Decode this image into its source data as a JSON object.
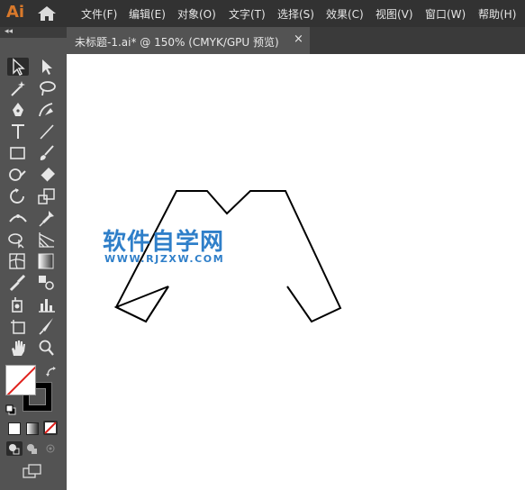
{
  "app": {
    "logo_text": "Ai"
  },
  "menu": {
    "items": [
      "文件(F)",
      "编辑(E)",
      "对象(O)",
      "文字(T)",
      "选择(S)",
      "效果(C)",
      "视图(V)",
      "窗口(W)",
      "帮助(H)"
    ]
  },
  "document": {
    "tab_title": "未标题-1.ai* @ 150% (CMYK/GPU 预览)",
    "close_glyph": "×"
  },
  "toolbar": {
    "collapse_glyph": "◂◂",
    "tools": [
      "selection-tool",
      "direct-selection-tool",
      "magic-wand-tool",
      "lasso-tool",
      "pen-tool",
      "curvature-tool",
      "type-tool",
      "line-segment-tool",
      "rectangle-tool",
      "paintbrush-tool",
      "shaper-tool",
      "eraser-tool",
      "rotate-tool",
      "scale-tool",
      "width-tool",
      "puppet-warp-tool",
      "shape-builder-tool",
      "perspective-grid-tool",
      "mesh-tool",
      "gradient-tool",
      "eyedropper-tool",
      "blend-tool",
      "symbol-sprayer-tool",
      "column-graph-tool",
      "artboard-tool",
      "slice-tool",
      "hand-tool",
      "zoom-tool"
    ]
  },
  "colors": {
    "fill": "none",
    "stroke": "#000000",
    "accent": "#d9792b"
  },
  "watermark": {
    "cn": "软件自学网",
    "url": "WWW.RJZXW.COM"
  }
}
